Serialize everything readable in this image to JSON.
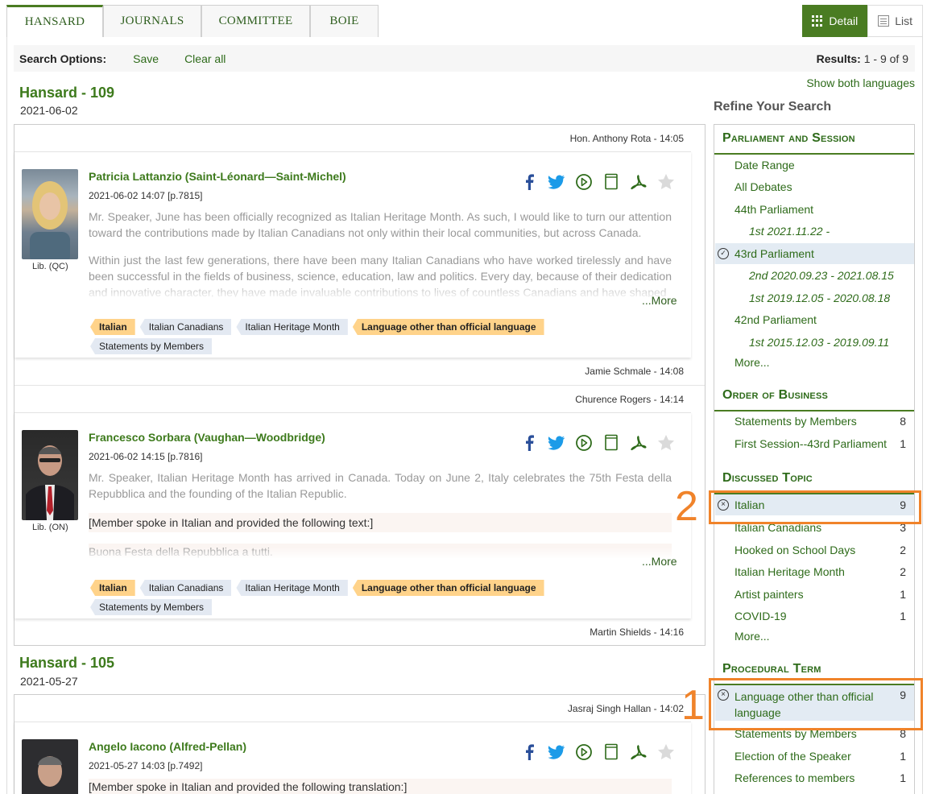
{
  "tabs": [
    "HANSARD",
    "JOURNALS",
    "COMMITTEE",
    "BOIE"
  ],
  "view": {
    "detail": "Detail",
    "list": "List"
  },
  "search_options": {
    "label": "Search Options:",
    "save": "Save",
    "clear": "Clear all",
    "results_label": "Results:",
    "results_value": "1 - 9 of 9"
  },
  "show_both": "Show both languages",
  "hansards": [
    {
      "title": "Hansard - 109",
      "date": "2021-06-02"
    },
    {
      "title": "Hansard - 105",
      "date": "2021-05-27"
    }
  ],
  "speaker_lines": [
    "Hon. Anthony Rota - 14:05",
    "Jamie Schmale - 14:08",
    "Churence Rogers - 14:14",
    "Martin Shields - 14:16",
    "Jasraj Singh Hallan - 14:02"
  ],
  "interventions": [
    {
      "name": "Patricia Lattanzio (Saint-Léonard—Saint-Michel)",
      "meta": "2021-06-02 14:07 [p.7815]",
      "party": "Lib. (QC)",
      "p1": "Mr. Speaker, June has been officially recognized as Italian Heritage Month. As such, I would like to turn our attention toward the contributions made by Italian Canadians not only within their local communities, but across Canada.",
      "p2": "Within just the last few generations, there have been many Italian Canadians who have worked tirelessly and have been successful in the fields of business, science, education, law and politics. Every day, because of their dedication and innovative character, they have made invaluable contributions to lives of countless Canadians and have shaped",
      "more": "...More",
      "tags": [
        "Italian",
        "Italian Canadians",
        "Italian Heritage Month",
        "Language other than official language",
        "Statements by Members"
      ]
    },
    {
      "name": "Francesco Sorbara (Vaughan—Woodbridge)",
      "meta": "2021-06-02 14:15 [p.7816]",
      "party": "Lib. (ON)",
      "p1": "Mr. Speaker, Italian Heritage Month has arrived in Canada. Today on June 2, Italy celebrates the 75th Festa della Repubblica and the founding of the Italian Republic.",
      "p2": "[Member spoke in Italian and provided the following text:]",
      "p3": "Buona Festa della Repubblica a tutti.",
      "more": "...More",
      "tags": [
        "Italian",
        "Italian Canadians",
        "Italian Heritage Month",
        "Language other than official language",
        "Statements by Members"
      ]
    },
    {
      "name": "Angelo Iacono (Alfred-Pellan)",
      "meta": "2021-05-27 14:03 [p.7492]",
      "p1": "[Member spoke in Italian and provided the following translation:]"
    }
  ],
  "refine": {
    "title": "Refine Your Search",
    "parliament_title": "Parliament and Session",
    "parliament_items": [
      "Date Range",
      "All Debates",
      "44th Parliament",
      "1st 2021.11.22 -",
      "43rd Parliament",
      "2nd 2020.09.23 - 2021.08.15",
      "1st 2019.12.05 - 2020.08.18",
      "42nd Parliament",
      "1st 2015.12.03 - 2019.09.11",
      "More..."
    ],
    "order_title": "Order of Business",
    "order_items": [
      {
        "label": "Statements by Members",
        "count": "8"
      },
      {
        "label": "First Session--43rd Parliament",
        "count": "1"
      }
    ],
    "topic_title": "Discussed Topic",
    "topic_items": [
      {
        "label": "Italian",
        "count": "9"
      },
      {
        "label": "Italian Canadians",
        "count": "3"
      },
      {
        "label": "Hooked on School Days",
        "count": "2"
      },
      {
        "label": "Italian Heritage Month",
        "count": "2"
      },
      {
        "label": "Artist painters",
        "count": "1"
      },
      {
        "label": "COVID-19",
        "count": "1"
      }
    ],
    "topic_more": "More...",
    "proc_title": "Procedural Term",
    "proc_items": [
      {
        "label": "Language other than official language",
        "count": "9"
      },
      {
        "label": "Statements by Members",
        "count": "8"
      },
      {
        "label": "Election of the Speaker",
        "count": "1"
      },
      {
        "label": "References to members",
        "count": "1"
      }
    ]
  },
  "annotations": [
    "1",
    "2"
  ],
  "colors": {
    "accent": "#4a7c22",
    "highlight_tag": "#ffd38a",
    "annotation": "#f0832a"
  }
}
